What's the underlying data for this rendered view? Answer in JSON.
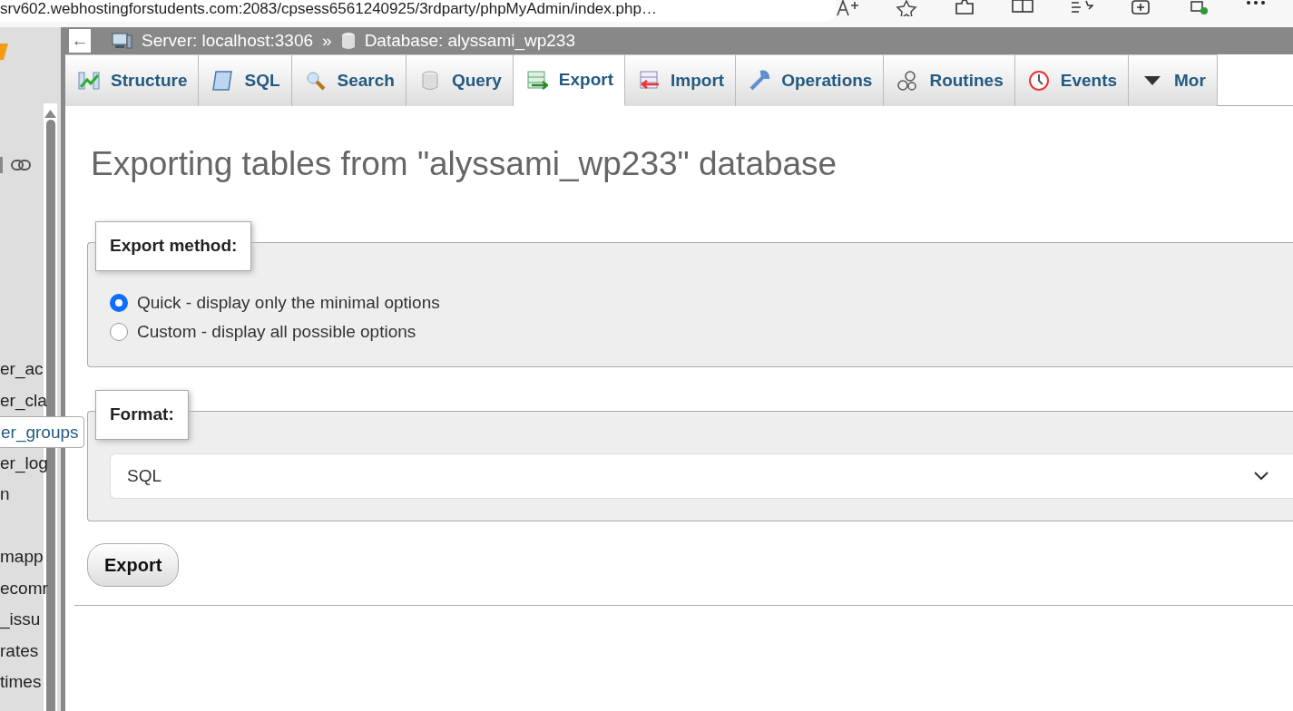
{
  "browser": {
    "address": "srv602.webhostingforstudents.com:2083/cpsess6561240925/3rdparty/phpMyAdmin/index.php…"
  },
  "breadcrumb": {
    "back": "←",
    "server": "Server: localhost:3306",
    "separator": "»",
    "database": "Database: alyssami_wp233"
  },
  "tabs": [
    {
      "label": "Structure",
      "selected": false
    },
    {
      "label": "SQL",
      "selected": false
    },
    {
      "label": "Search",
      "selected": false
    },
    {
      "label": "Query",
      "selected": false
    },
    {
      "label": "Export",
      "selected": true
    },
    {
      "label": "Import",
      "selected": false
    },
    {
      "label": "Operations",
      "selected": false
    },
    {
      "label": "Routines",
      "selected": false
    },
    {
      "label": "Events",
      "selected": false
    },
    {
      "label": "Mor",
      "selected": false
    }
  ],
  "sidebar": {
    "items": [
      {
        "label": "er_ac",
        "selected": false
      },
      {
        "label": "er_cla",
        "selected": false
      },
      {
        "label": "er_groups",
        "selected": true
      },
      {
        "label": "er_log",
        "selected": false
      },
      {
        "label": "n",
        "selected": false
      },
      {
        "label": "mapp",
        "selected": false
      },
      {
        "label": "ecomr",
        "selected": false
      },
      {
        "label": "_issu",
        "selected": false
      },
      {
        "label": "rates",
        "selected": false
      },
      {
        "label": "times",
        "selected": false
      }
    ]
  },
  "heading": "Exporting tables from \"alyssami_wp233\" database",
  "export_method": {
    "legend": "Export method:",
    "options": [
      {
        "label": "Quick - display only the minimal options",
        "selected": true
      },
      {
        "label": "Custom - display all possible options",
        "selected": false
      }
    ]
  },
  "format": {
    "legend": "Format:",
    "value": "SQL"
  },
  "submit": "Export"
}
